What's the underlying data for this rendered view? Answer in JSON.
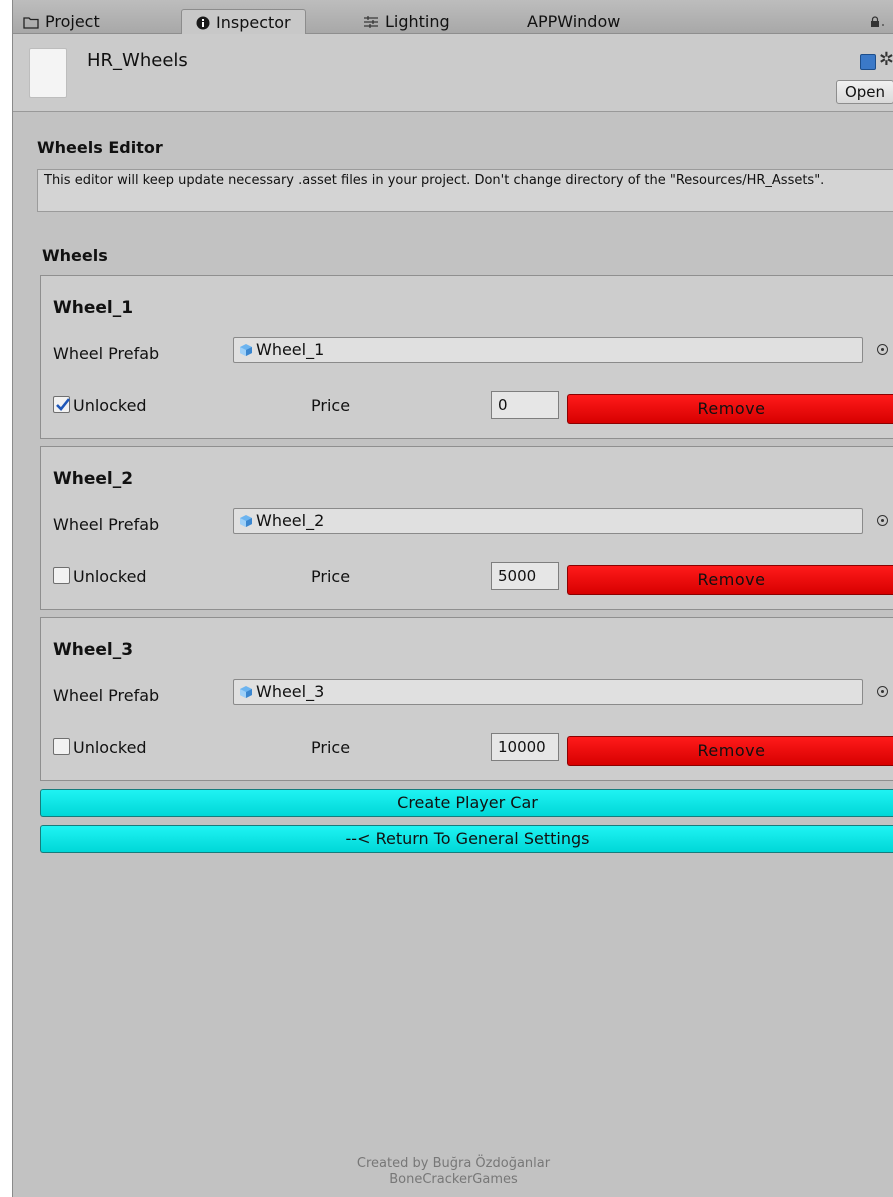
{
  "tabs": [
    {
      "label": "Project",
      "icon": "folder-icon"
    },
    {
      "label": "Inspector",
      "icon": "info-icon"
    },
    {
      "label": "Lighting",
      "icon": "lighting-icon"
    },
    {
      "label": "APPWindow",
      "icon": ""
    }
  ],
  "header": {
    "asset_name": "HR_Wheels",
    "open_label": "Open"
  },
  "editor": {
    "title": "Wheels Editor",
    "help_text": "This editor will keep update necessary .asset files in your project. Don't change directory of the \"Resources/HR_Assets\".",
    "wheels_heading": "Wheels"
  },
  "wheels": [
    {
      "name": "Wheel_1",
      "prefab_label": "Wheel Prefab",
      "prefab_value": "Wheel_1",
      "unlocked": true,
      "unlocked_label": "Unlocked",
      "price_label": "Price",
      "price": "0",
      "remove_label": "Remove"
    },
    {
      "name": "Wheel_2",
      "prefab_label": "Wheel Prefab",
      "prefab_value": "Wheel_2",
      "unlocked": false,
      "unlocked_label": "Unlocked",
      "price_label": "Price",
      "price": "5000",
      "remove_label": "Remove"
    },
    {
      "name": "Wheel_3",
      "prefab_label": "Wheel Prefab",
      "prefab_value": "Wheel_3",
      "unlocked": false,
      "unlocked_label": "Unlocked",
      "price_label": "Price",
      "price": "10000",
      "remove_label": "Remove"
    }
  ],
  "actions": {
    "create_label": "Create Player Car",
    "return_label": "--< Return To General Settings"
  },
  "footer": {
    "line1": "Created by Buğra Özdoğanlar",
    "line2": "BoneCrackerGames"
  },
  "colors": {
    "remove": "#ff0000",
    "action": "#00e0e0",
    "panel": "#c2c2c2"
  }
}
